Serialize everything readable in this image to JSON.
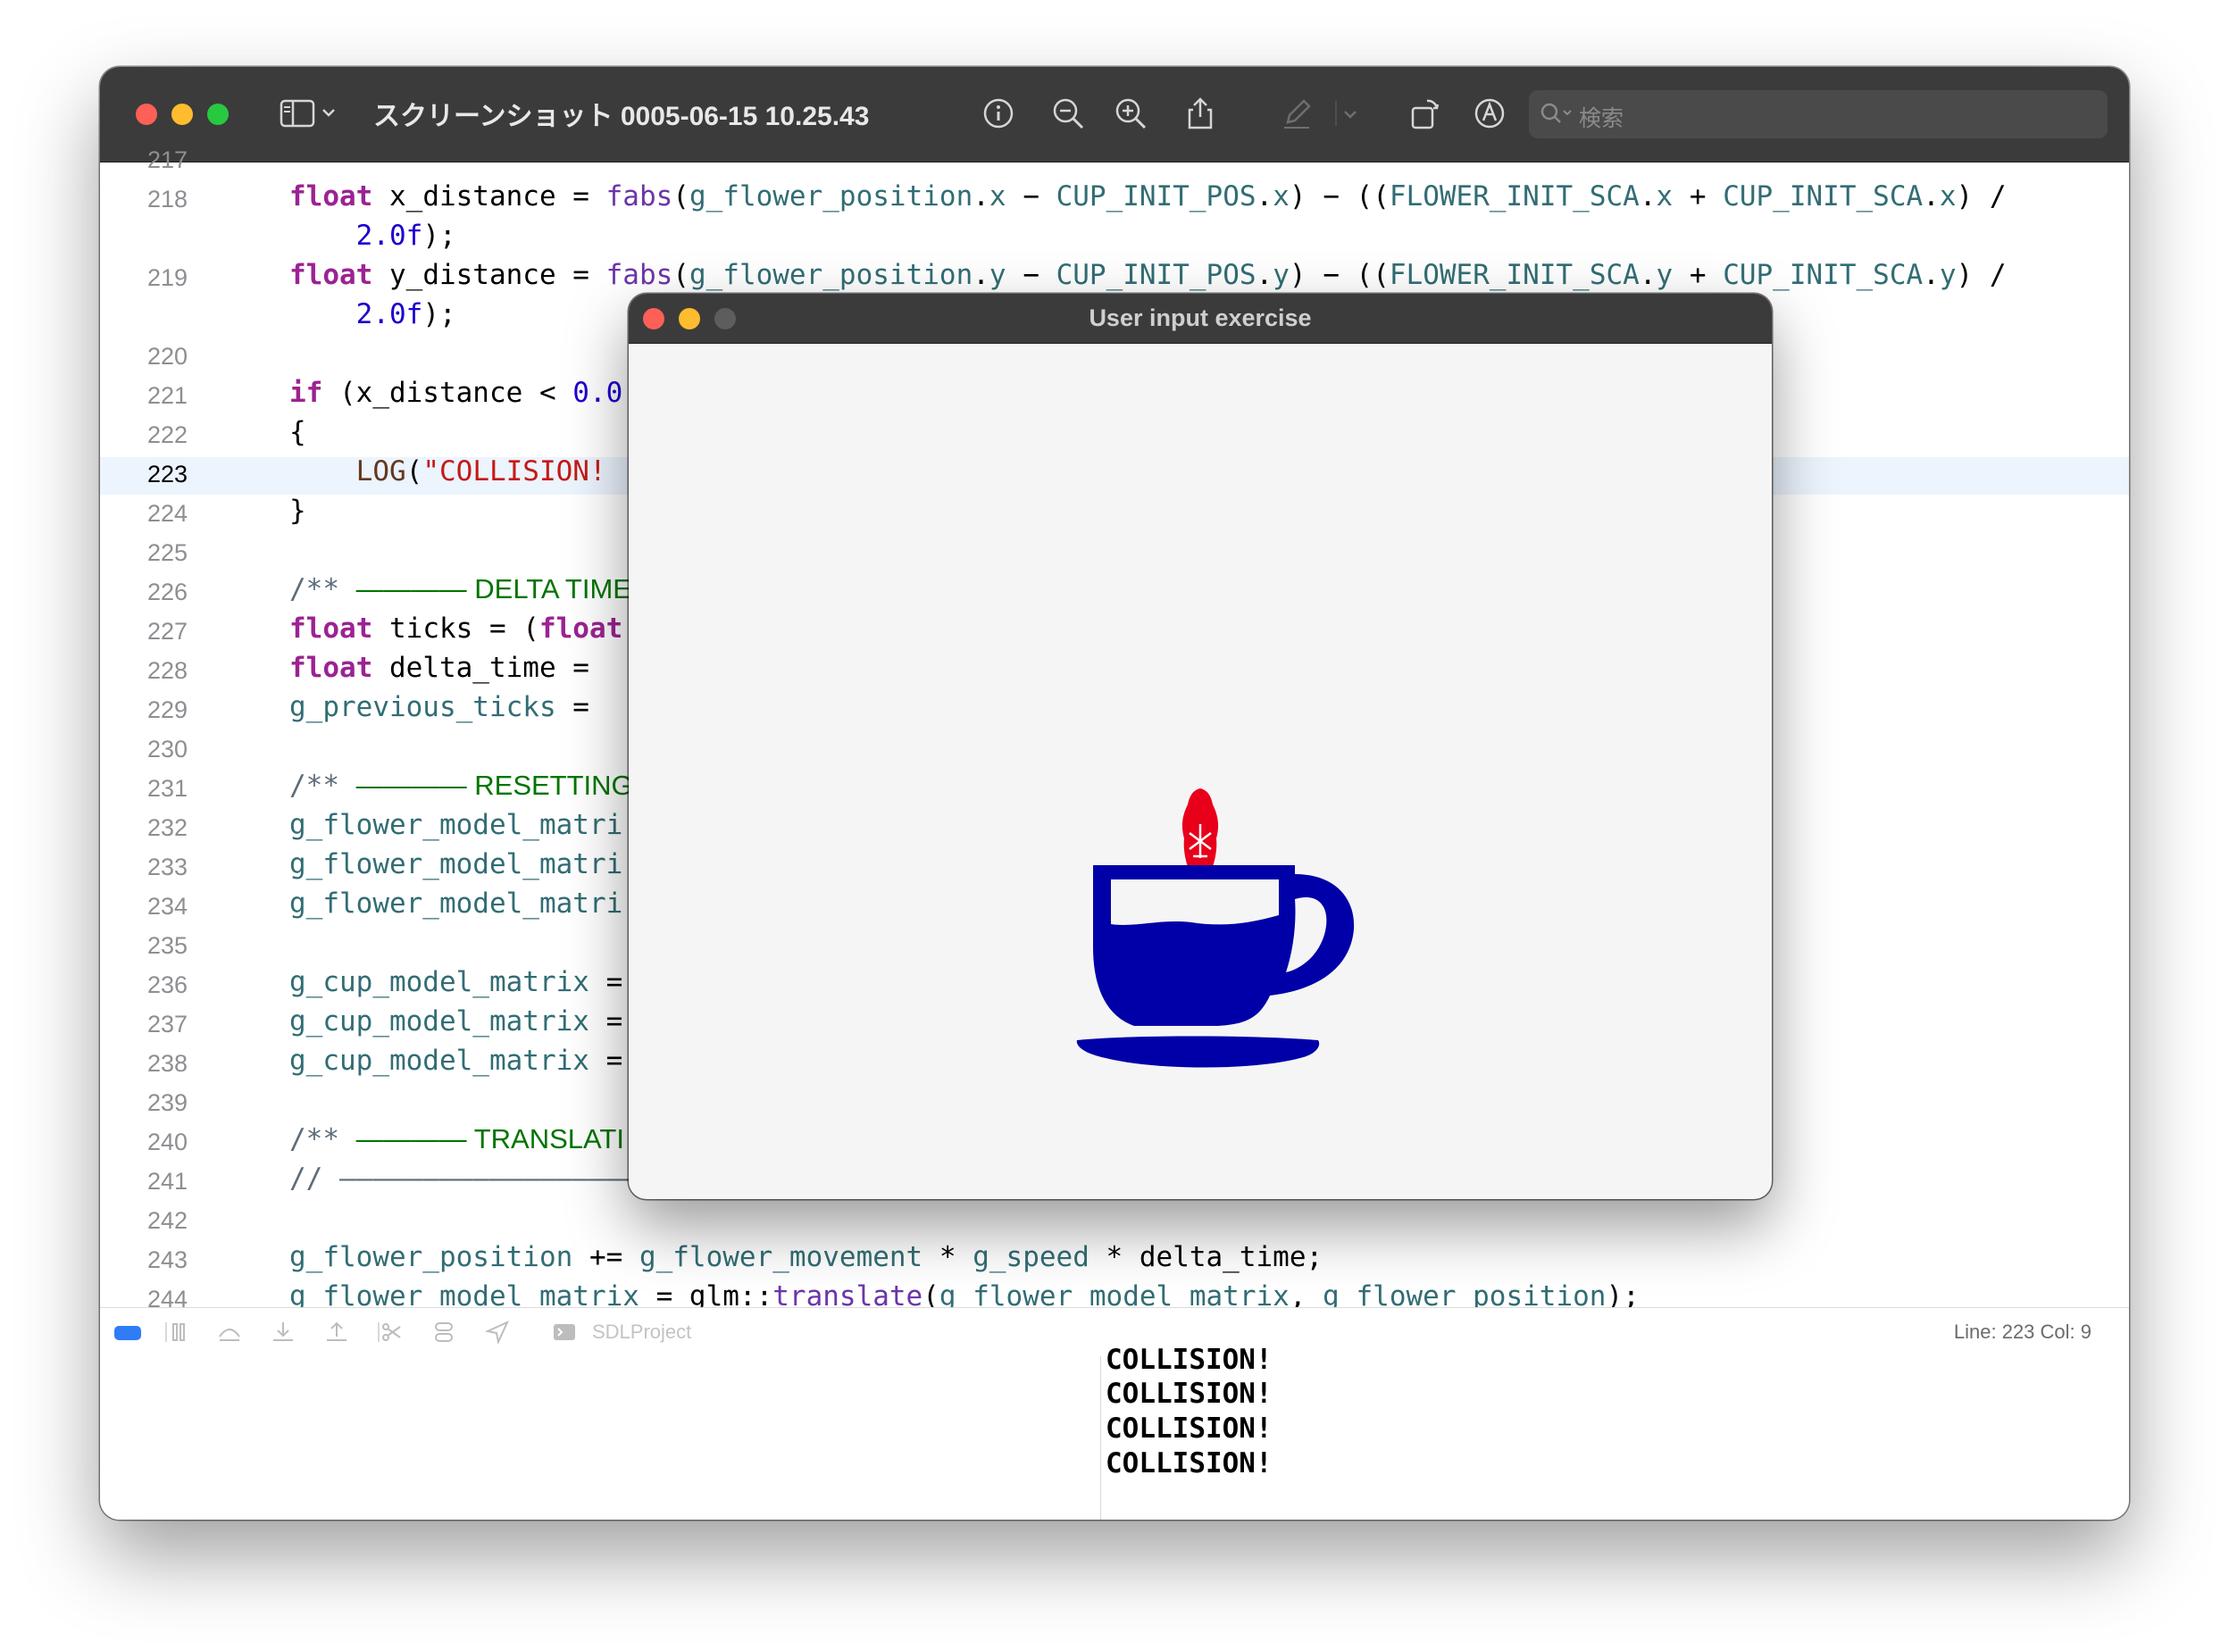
{
  "window": {
    "title": "スクリーンショット 0005-06-15 10.25.43",
    "search_placeholder": "検索"
  },
  "editor": {
    "lines": [
      {
        "n": "217",
        "tokens": [
          [
            "nm",
            ""
          ]
        ]
      },
      {
        "n": "218",
        "tokens": [
          [
            "kw",
            "float"
          ],
          [
            "pl",
            " x_distance = "
          ],
          [
            "fn",
            "fabs"
          ],
          [
            "pl",
            "("
          ],
          [
            "nm",
            "g_flower_position"
          ],
          [
            "pl",
            "."
          ],
          [
            "nm",
            "x"
          ],
          [
            "pl",
            " − "
          ],
          [
            "nm",
            "CUP_INIT_POS"
          ],
          [
            "pl",
            "."
          ],
          [
            "nm",
            "x"
          ],
          [
            "pl",
            ") − (("
          ],
          [
            "nm",
            "FLOWER_INIT_SCA"
          ],
          [
            "pl",
            "."
          ],
          [
            "nm",
            "x"
          ],
          [
            "pl",
            " + "
          ],
          [
            "nm",
            "CUP_INIT_SCA"
          ],
          [
            "pl",
            "."
          ],
          [
            "nm",
            "x"
          ],
          [
            "pl",
            ") /"
          ]
        ]
      },
      {
        "n": "",
        "tokens": [
          [
            "pl",
            "    "
          ],
          [
            "num",
            "2.0f"
          ],
          [
            "pl",
            ");"
          ]
        ]
      },
      {
        "n": "219",
        "tokens": [
          [
            "kw",
            "float"
          ],
          [
            "pl",
            " y_distance = "
          ],
          [
            "fn",
            "fabs"
          ],
          [
            "pl",
            "("
          ],
          [
            "nm",
            "g_flower_position"
          ],
          [
            "pl",
            "."
          ],
          [
            "nm",
            "y"
          ],
          [
            "pl",
            " − "
          ],
          [
            "nm",
            "CUP_INIT_POS"
          ],
          [
            "pl",
            "."
          ],
          [
            "nm",
            "y"
          ],
          [
            "pl",
            ") − (("
          ],
          [
            "nm",
            "FLOWER_INIT_SCA"
          ],
          [
            "pl",
            "."
          ],
          [
            "nm",
            "y"
          ],
          [
            "pl",
            " + "
          ],
          [
            "nm",
            "CUP_INIT_SCA"
          ],
          [
            "pl",
            "."
          ],
          [
            "nm",
            "y"
          ],
          [
            "pl",
            ") /"
          ]
        ]
      },
      {
        "n": "",
        "tokens": [
          [
            "pl",
            "    "
          ],
          [
            "num",
            "2.0f"
          ],
          [
            "pl",
            ");"
          ]
        ]
      },
      {
        "n": "220",
        "tokens": []
      },
      {
        "n": "221",
        "tokens": [
          [
            "kw",
            "if"
          ],
          [
            "pl",
            " (x_distance < "
          ],
          [
            "num",
            "0.0"
          ]
        ]
      },
      {
        "n": "222",
        "tokens": [
          [
            "pl",
            "{"
          ]
        ]
      },
      {
        "n": "223",
        "tokens": [
          [
            "pl",
            "    "
          ],
          [
            "macro",
            "LOG"
          ],
          [
            "pl",
            "("
          ],
          [
            "str",
            "\"COLLISION!"
          ]
        ]
      },
      {
        "n": "224",
        "tokens": [
          [
            "pl",
            "}"
          ]
        ]
      },
      {
        "n": "225",
        "tokens": []
      },
      {
        "n": "226",
        "tokens": [
          [
            "cmt",
            "/** "
          ],
          [
            "doc",
            "———— DELTA TIME"
          ]
        ]
      },
      {
        "n": "227",
        "tokens": [
          [
            "kw",
            "float"
          ],
          [
            "pl",
            " ticks = ("
          ],
          [
            "kw",
            "float"
          ]
        ]
      },
      {
        "n": "228",
        "tokens": [
          [
            "kw",
            "float"
          ],
          [
            "pl",
            " delta_time = "
          ]
        ]
      },
      {
        "n": "229",
        "tokens": [
          [
            "nm",
            "g_previous_ticks"
          ],
          [
            "pl",
            " = "
          ]
        ]
      },
      {
        "n": "230",
        "tokens": []
      },
      {
        "n": "231",
        "tokens": [
          [
            "cmt",
            "/** "
          ],
          [
            "doc",
            "———— RESETTING"
          ]
        ]
      },
      {
        "n": "232",
        "tokens": [
          [
            "nm",
            "g_flower_model_matri"
          ]
        ]
      },
      {
        "n": "233",
        "tokens": [
          [
            "nm",
            "g_flower_model_matri"
          ]
        ]
      },
      {
        "n": "234",
        "tokens": [
          [
            "nm",
            "g_flower_model_matri"
          ]
        ]
      },
      {
        "n": "235",
        "tokens": []
      },
      {
        "n": "236",
        "tokens": [
          [
            "nm",
            "g_cup_model_matrix"
          ],
          [
            "pl",
            " ="
          ]
        ]
      },
      {
        "n": "237",
        "tokens": [
          [
            "nm",
            "g_cup_model_matrix"
          ],
          [
            "pl",
            " ="
          ]
        ]
      },
      {
        "n": "238",
        "tokens": [
          [
            "nm",
            "g_cup_model_matrix"
          ],
          [
            "pl",
            " ="
          ]
        ]
      },
      {
        "n": "239",
        "tokens": []
      },
      {
        "n": "240",
        "tokens": [
          [
            "cmt",
            "/** "
          ],
          [
            "doc",
            "———— TRANSLATI"
          ]
        ]
      },
      {
        "n": "241",
        "tokens": [
          [
            "cmt",
            "// ———————————————————"
          ]
        ]
      },
      {
        "n": "242",
        "tokens": []
      },
      {
        "n": "243",
        "tokens": [
          [
            "nm",
            "g_flower_position"
          ],
          [
            "pl",
            " += "
          ],
          [
            "nm",
            "g_flower_movement"
          ],
          [
            "pl",
            " * "
          ],
          [
            "nm",
            "g_speed"
          ],
          [
            "pl",
            " * delta_time;"
          ]
        ]
      },
      {
        "n": "244",
        "tokens": [
          [
            "nm",
            "g_flower_model_matrix"
          ],
          [
            "pl",
            " = glm::"
          ],
          [
            "fn",
            "translate"
          ],
          [
            "pl",
            "("
          ],
          [
            "nm",
            "g_flower_model_matrix"
          ],
          [
            "pl",
            ", "
          ],
          [
            "nm",
            "g_flower_position"
          ],
          [
            "pl",
            ");"
          ]
        ]
      }
    ],
    "current_line": "223"
  },
  "debugbar": {
    "target_label": "SDLProject",
    "line_col": "Line: 223  Col: 9"
  },
  "console": {
    "partial_line": "COLLISION!",
    "lines": [
      "COLLISION!",
      "COLLISION!",
      "COLLISION!"
    ]
  },
  "sdl_window": {
    "title": "User input exercise",
    "flower_color": "#e8001a",
    "cup_color": "#0000a8"
  }
}
